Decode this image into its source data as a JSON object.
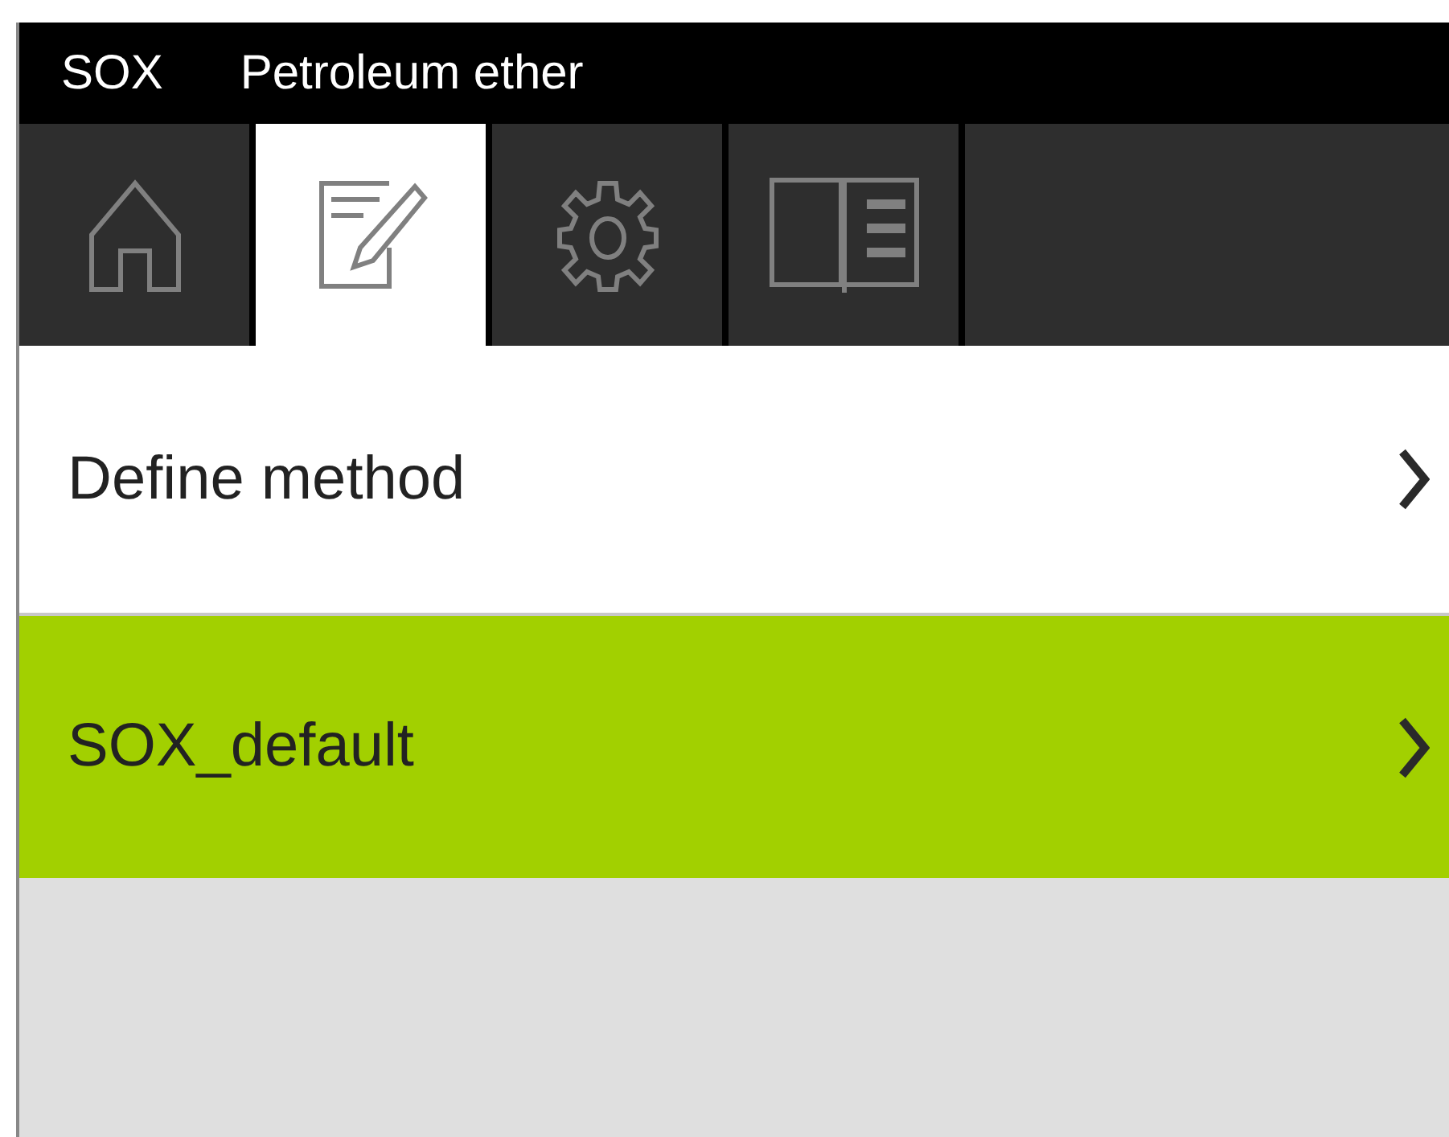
{
  "header": {
    "program": "SOX",
    "solvent": "Petroleum ether"
  },
  "tabs": [
    {
      "kind": "home",
      "selected": false
    },
    {
      "kind": "edit",
      "selected": true
    },
    {
      "kind": "settings",
      "selected": false
    },
    {
      "kind": "manual",
      "selected": false
    }
  ],
  "menu": [
    {
      "label": "Define method",
      "selected": false
    },
    {
      "label": "SOX_default",
      "selected": true
    }
  ]
}
